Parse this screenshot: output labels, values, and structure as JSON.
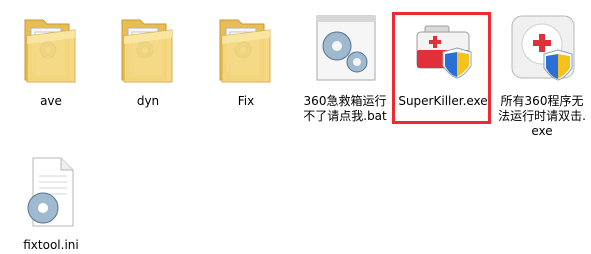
{
  "files": [
    {
      "name": "ave",
      "type": "folder"
    },
    {
      "name": "dyn",
      "type": "folder"
    },
    {
      "name": "Fix",
      "type": "folder"
    },
    {
      "name": "360急救箱运行不了请点我.bat",
      "type": "bat-file"
    },
    {
      "name": "SuperKiller.exe",
      "type": "exe-toolbox",
      "selected": true
    },
    {
      "name": "所有360程序无法运行时请双击.exe",
      "type": "exe-shield"
    },
    {
      "name": "fixtool.ini",
      "type": "ini-file"
    }
  ],
  "colors": {
    "selection_border": "#ec2a2f",
    "folder_main": "#f2cb6a",
    "toolbox_red": "#e2303a",
    "shield_blue": "#2b6fd6",
    "shield_yellow": "#f5c21b"
  },
  "icons": {
    "folder": "folder-icon",
    "bat": "gear-document-icon",
    "toolbox": "first-aid-kit-icon",
    "shield_app": "red-cross-shield-icon",
    "ini": "gear-document-icon"
  }
}
